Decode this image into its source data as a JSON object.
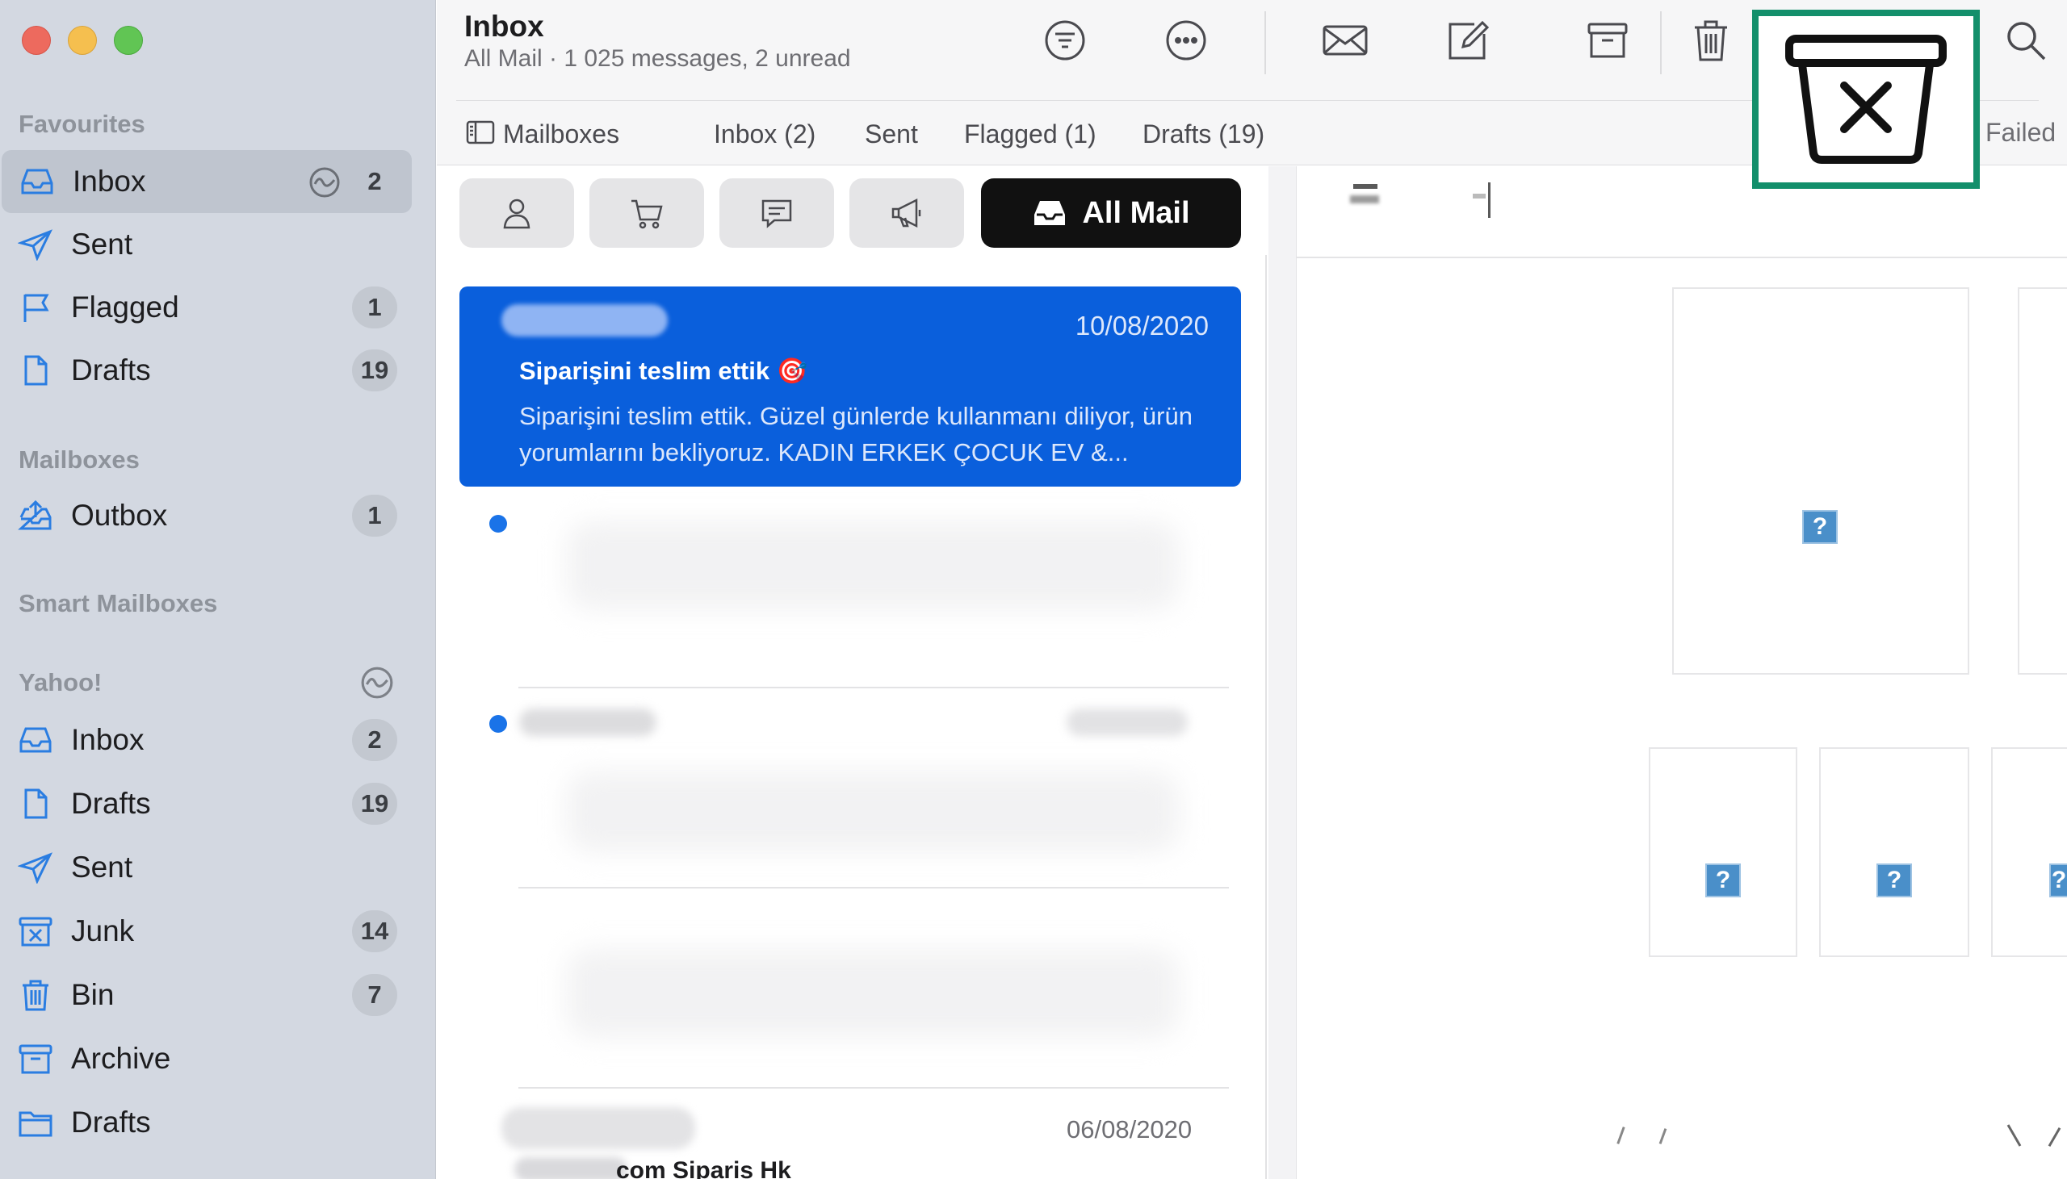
{
  "window": {
    "title": "Inbox",
    "subtitle": "All Mail · 1 025 messages, 2 unread"
  },
  "sidebar": {
    "favourites_title": "Favourites",
    "favourites": [
      {
        "label": "Inbox",
        "badge": "2",
        "icon": "inbox-icon"
      },
      {
        "label": "Sent",
        "badge": "",
        "icon": "sent-icon"
      },
      {
        "label": "Flagged",
        "badge": "1",
        "icon": "flag-icon"
      },
      {
        "label": "Drafts",
        "badge": "19",
        "icon": "drafts-icon"
      }
    ],
    "mailboxes_title": "Mailboxes",
    "mailboxes": [
      {
        "label": "Outbox",
        "badge": "1",
        "icon": "outbox-icon"
      }
    ],
    "smart_title": "Smart Mailboxes",
    "yahoo_title": "Yahoo!",
    "yahoo": [
      {
        "label": "Inbox",
        "badge": "2",
        "icon": "inbox-icon"
      },
      {
        "label": "Drafts",
        "badge": "19",
        "icon": "drafts-icon"
      },
      {
        "label": "Sent",
        "badge": "",
        "icon": "sent-icon"
      },
      {
        "label": "Junk",
        "badge": "14",
        "icon": "junk-icon"
      },
      {
        "label": "Bin",
        "badge": "7",
        "icon": "bin-icon"
      },
      {
        "label": "Archive",
        "badge": "",
        "icon": "archive-icon"
      },
      {
        "label": "Drafts",
        "badge": "",
        "icon": "folder-icon"
      }
    ]
  },
  "favourites_bar": {
    "mailboxes": "Mailboxes",
    "inbox": "Inbox (2)",
    "sent": "Sent",
    "flagged": "Flagged (1)",
    "drafts": "Drafts (19)",
    "failed": "Failed"
  },
  "filters": {
    "all_mail": "All Mail"
  },
  "messages": {
    "selected": {
      "date": "10/08/2020",
      "subject": "Siparişini teslim ettik 🎯",
      "preview": "Siparişini teslim ettik. Güzel günlerde kullanmanı diliyor, ürün yorumlarını bekliyoruz. KADIN ERKEK ÇOCUK EV &..."
    },
    "row3_date": "06/08/2020",
    "row3_sender_fragment": "com Siparis Hk"
  },
  "colors": {
    "accent": "#0a5fdc",
    "highlight": "#138f6b",
    "sidebar": "#d3d8e1"
  }
}
